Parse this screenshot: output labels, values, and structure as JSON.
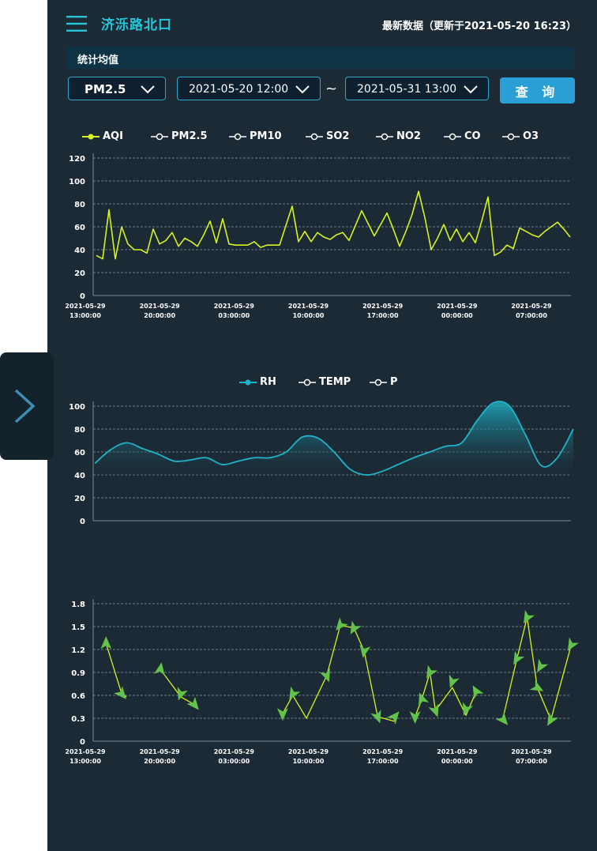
{
  "header": {
    "station_name": "济泺路北口",
    "latest_data": "最新数据（更新于2021-05-20  16:23）"
  },
  "section": {
    "title": "统计均值"
  },
  "filters": {
    "pollutant": "PM2.5",
    "start_time": "2021-05-20 12:00",
    "separator": "~",
    "end_time": "2021-05-31 13:00",
    "query_label": "查 询"
  },
  "colors": {
    "aqi": "#d7f21e",
    "rh": "#1fb3c7",
    "wind": "#62c24a",
    "panel": "#1b2a35"
  },
  "chart_data": [
    {
      "type": "line",
      "legend": [
        "AQI",
        "PM2.5",
        "PM10",
        "SO2",
        "NO2",
        "CO",
        "O3"
      ],
      "active_series": "AQI",
      "x_ticks": [
        "2021-05-29\n13:00:00",
        "2021-05-29\n20:00:00",
        "2021-05-29\n03:00:00",
        "2021-05-29\n10:00:00",
        "2021-05-29\n17:00:00",
        "2021-05-29\n00:00:00",
        "2021-05-29\n07:00:00"
      ],
      "ylim": [
        0,
        120
      ],
      "y_ticks": [
        0,
        20,
        40,
        60,
        80,
        100,
        120
      ],
      "grid": true,
      "series": [
        {
          "name": "AQI",
          "values": [
            35,
            32,
            75,
            32,
            60,
            45,
            40,
            40,
            37,
            58,
            45,
            48,
            55,
            43,
            50,
            47,
            43,
            53,
            65,
            46,
            67,
            45,
            44,
            44,
            44,
            47,
            42,
            44,
            44,
            44,
            61,
            78,
            47,
            56,
            47,
            55,
            51,
            49,
            53,
            55,
            48,
            61,
            74,
            63,
            52,
            62,
            72,
            58,
            43,
            56,
            71,
            91,
            68,
            40,
            50,
            62,
            48,
            58,
            47,
            55,
            46,
            65,
            86,
            35,
            38,
            44,
            41,
            59,
            56,
            53,
            51,
            56,
            60,
            64,
            58,
            51
          ]
        }
      ]
    },
    {
      "type": "area",
      "legend": [
        "RH",
        "TEMP",
        "P"
      ],
      "active_series": "RH",
      "ylim": [
        0,
        100
      ],
      "y_ticks": [
        0,
        20,
        40,
        60,
        80,
        100
      ],
      "grid": true,
      "series": [
        {
          "name": "RH",
          "values": [
            50,
            62,
            68,
            63,
            58,
            52,
            53,
            55,
            49,
            52,
            55,
            55,
            60,
            73,
            72,
            60,
            45,
            40,
            43,
            49,
            55,
            60,
            65,
            68,
            88,
            103,
            100,
            75,
            48,
            55,
            80
          ]
        }
      ]
    },
    {
      "type": "scatter",
      "x_ticks": [
        "2021-05-29\n13:00:00",
        "2021-05-29\n20:00:00",
        "2021-05-29\n03:00:00",
        "2021-05-29\n10:00:00",
        "2021-05-29\n17:00:00",
        "2021-05-29\n00:00:00",
        "2021-05-29\n07:00:00"
      ],
      "ylim": [
        0,
        1.8
      ],
      "y_ticks": [
        "0",
        "0.3",
        "0.6",
        "0.9",
        "1.2",
        "1.5",
        "1.8"
      ],
      "grid": true,
      "symbol": "arrow",
      "segments": [
        [
          [
            0.5,
            1.28
          ],
          [
            2.8,
            0.62
          ],
          [
            3.5,
            0.58
          ]
        ],
        [
          [
            8.5,
            0.94
          ],
          [
            11.5,
            0.58
          ],
          [
            13.5,
            0.48
          ]
        ],
        [
          [
            26.5,
            0.36
          ],
          [
            28,
            0.6
          ],
          [
            30,
            0.3
          ],
          [
            33,
            0.86
          ],
          [
            35,
            1.52
          ],
          [
            37,
            1.48
          ],
          [
            38.5,
            1.18
          ],
          [
            40.5,
            0.32
          ],
          [
            43,
            0.26
          ]
        ],
        [
          [
            46,
            0.32
          ],
          [
            47,
            0.55
          ],
          [
            48.2,
            0.9
          ],
          [
            49,
            0.4
          ],
          [
            51.5,
            0.7
          ],
          [
            53.5,
            0.34
          ],
          [
            55,
            0.65
          ]
        ],
        [
          [
            59,
            0.32
          ],
          [
            61,
            1.08
          ],
          [
            62.5,
            1.62
          ],
          [
            64,
            0.7
          ],
          [
            66,
            0.28
          ],
          [
            69,
            1.26
          ]
        ]
      ],
      "arrows": [
        [
          0.5,
          1.28,
          0
        ],
        [
          2.8,
          0.62,
          140
        ],
        [
          8.5,
          0.94,
          10
        ],
        [
          11.5,
          0.62,
          200
        ],
        [
          13.5,
          0.48,
          140
        ],
        [
          26.5,
          0.36,
          180
        ],
        [
          28,
          0.62,
          210
        ],
        [
          33,
          0.86,
          160
        ],
        [
          35,
          1.52,
          220
        ],
        [
          37,
          1.48,
          210
        ],
        [
          38.5,
          1.18,
          190
        ],
        [
          40.5,
          0.32,
          160
        ],
        [
          43,
          0.32,
          40
        ],
        [
          46,
          0.32,
          180
        ],
        [
          47,
          0.55,
          340
        ],
        [
          48.2,
          0.9,
          210
        ],
        [
          49,
          0.4,
          160
        ],
        [
          51.5,
          0.78,
          200
        ],
        [
          53.5,
          0.42,
          200
        ],
        [
          55,
          0.65,
          330
        ],
        [
          59,
          0.28,
          140
        ],
        [
          61,
          1.08,
          210
        ],
        [
          62.5,
          1.62,
          210
        ],
        [
          64,
          0.7,
          120
        ],
        [
          64.5,
          0.98,
          210
        ],
        [
          66,
          0.28,
          210
        ],
        [
          69,
          1.26,
          210
        ]
      ]
    }
  ]
}
